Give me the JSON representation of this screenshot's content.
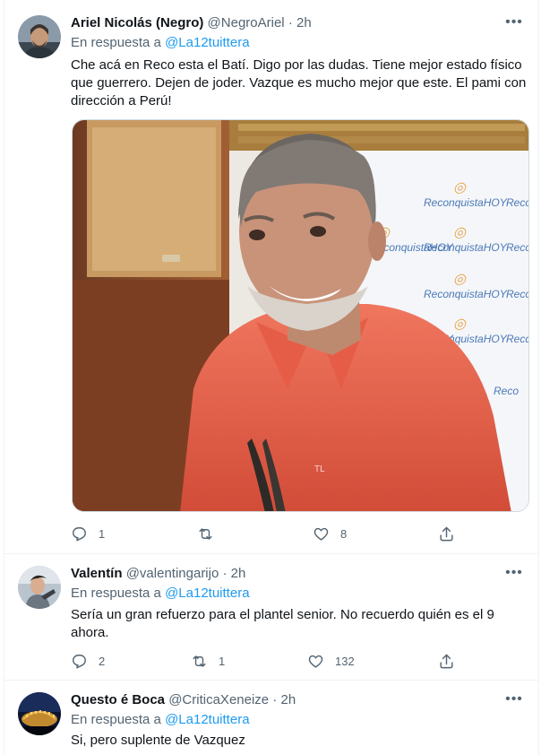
{
  "tweets": [
    {
      "name": "Ariel Nicolás (Negro)",
      "handle": "@NegroAriel",
      "time": "· 2h",
      "reply_prefix": "En respuesta a",
      "reply_to": "@La12tuittera",
      "text": "Che acá en Reco esta el Batí. Digo por las dudas. Tiene mejor estado físico que guerrero. Dejen de joder. Vazque es mucho mejor que este. El pami con dirección a Perú!",
      "replies": "1",
      "retweets": "",
      "likes": "8"
    },
    {
      "name": "Valentín",
      "handle": "@valentingarijo",
      "time": "· 2h",
      "reply_prefix": "En respuesta a",
      "reply_to": "@La12tuittera",
      "text": "Sería un gran refuerzo para el plantel senior. No recuerdo quién es el 9 ahora.",
      "replies": "2",
      "retweets": "1",
      "likes": "132"
    },
    {
      "name": "Questo é Boca",
      "handle": "@CriticaXeneize",
      "time": "· 2h",
      "reply_prefix": "En respuesta a",
      "reply_to": "@La12tuittera",
      "text": "Si, pero suplente de Vazquez"
    }
  ],
  "media": {
    "backdrop_brand": "ReconquistaHOY",
    "backdrop_brand_short": "Reco",
    "shirt_mark": "TL"
  },
  "colors": {
    "link": "#1d9bf0",
    "secondary": "#536471",
    "text": "#0f1419",
    "border": "#eff3f4"
  },
  "icons": [
    "more-icon",
    "reply-icon",
    "retweet-icon",
    "like-icon",
    "share-icon"
  ]
}
